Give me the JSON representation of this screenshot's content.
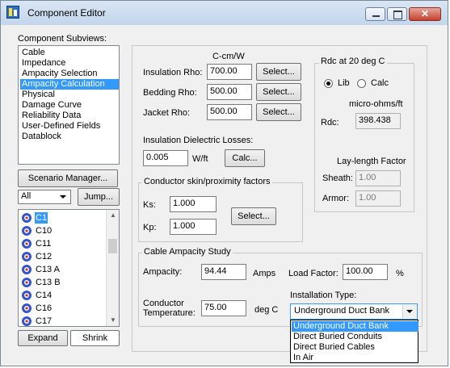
{
  "window": {
    "title": "Component Editor",
    "minimize_glyph": "—",
    "maximize_glyph": "□",
    "close_glyph": "✕"
  },
  "subviews": {
    "label": "Component Subviews:",
    "items": [
      "Cable",
      "Impedance",
      "Ampacity Selection",
      "Ampacity Calculation",
      "Physical",
      "Damage Curve",
      "Reliability Data",
      "User-Defined Fields",
      "Datablock"
    ],
    "selected_index": 3
  },
  "scenario_manager_label": "Scenario Manager...",
  "filter": {
    "value": "All",
    "jump_label": "Jump..."
  },
  "cables": {
    "items": [
      "C1",
      "C10",
      "C11",
      "C12",
      "C13 A",
      "C13 B",
      "C14",
      "C16",
      "C17"
    ],
    "selected_index": 0
  },
  "expand_label": "Expand",
  "shrink_label": "Shrink",
  "thermal": {
    "unit_header": "C-cm/W",
    "insulation_rho_label": "Insulation Rho:",
    "insulation_rho": "700.00",
    "bedding_rho_label": "Bedding Rho:",
    "bedding_rho": "500.00",
    "jacket_rho_label": "Jacket Rho:",
    "jacket_rho": "500.00",
    "select_label": "Select..."
  },
  "dielectric": {
    "label": "Insulation Dielectric Losses:",
    "value": "0.005",
    "unit": "W/ft",
    "calc_label": "Calc..."
  },
  "skin": {
    "title": "Conductor skin/proximity factors",
    "ks_label": "Ks:",
    "ks": "1.000",
    "kp_label": "Kp:",
    "kp": "1.000",
    "select_label": "Select..."
  },
  "rdc": {
    "title": "Rdc at 20 deg C",
    "lib_label": "Lib",
    "calc_label": "Calc",
    "selected": "Lib",
    "unit": "micro-ohms/ft",
    "rdc_label": "Rdc:",
    "rdc_value": "398.438",
    "laylength_title": "Lay-length Factor",
    "sheath_label": "Sheath:",
    "sheath": "1.00",
    "armor_label": "Armor:",
    "armor": "1.00"
  },
  "study": {
    "title": "Cable Ampacity Study",
    "ampacity_label": "Ampacity:",
    "ampacity": "94.44",
    "ampacity_unit": "Amps",
    "load_factor_label": "Load Factor:",
    "load_factor": "100.00",
    "load_factor_unit": "%",
    "temp_label_line1": "Conductor",
    "temp_label_line2": "Temperature:",
    "temperature": "75.00",
    "temp_unit": "deg C",
    "installation_label": "Installation Type:",
    "installation_value": "Underground Duct Bank",
    "installation_options": [
      "Underground Duct Bank",
      "Direct Buried Conduits",
      "Direct Buried Cables",
      "In Air"
    ],
    "highlighted_option": 0
  },
  "colors": {
    "selection": "#3399ff",
    "window_bg": "#f0f0f0",
    "close_red": "#c4412f"
  }
}
